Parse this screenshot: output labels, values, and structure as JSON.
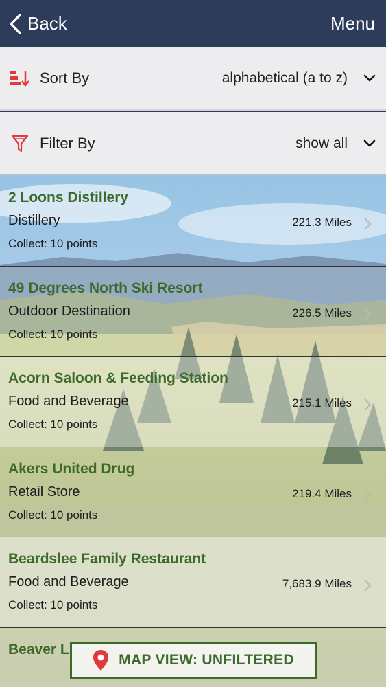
{
  "navbar": {
    "back_label": "Back",
    "menu_label": "Menu"
  },
  "sort": {
    "label": "Sort By",
    "value": "alphabetical (a to z)",
    "icon": "sort-icon"
  },
  "filter": {
    "label": "Filter By",
    "value": "show all",
    "icon": "funnel-icon"
  },
  "locations": [
    {
      "name": "2 Loons Distillery",
      "category": "Distillery",
      "distance": "221.3 Miles",
      "points": "Collect: 10 points"
    },
    {
      "name": "49 Degrees North Ski Resort",
      "category": "Outdoor Destination",
      "distance": "226.5 Miles",
      "points": "Collect: 10 points"
    },
    {
      "name": "Acorn Saloon & Feeding Station",
      "category": "Food and Beverage",
      "distance": "215.1 Miles",
      "points": "Collect: 10 points"
    },
    {
      "name": "Akers United Drug",
      "category": "Retail Store",
      "distance": "219.4 Miles",
      "points": "Collect: 10 points"
    },
    {
      "name": "Beardslee Family Restaurant",
      "category": "Food and Beverage",
      "distance": "7,683.9 Miles",
      "points": "Collect: 10 points"
    },
    {
      "name": "Beaver L",
      "category": "",
      "distance": "",
      "points": ""
    }
  ],
  "map_button": {
    "label": "MAP VIEW: UNFILTERED",
    "icon": "map-pin-icon"
  },
  "colors": {
    "navbar": "#2e3c5c",
    "accent_green": "#3c6a2a",
    "accent_red": "#e03a3a"
  }
}
